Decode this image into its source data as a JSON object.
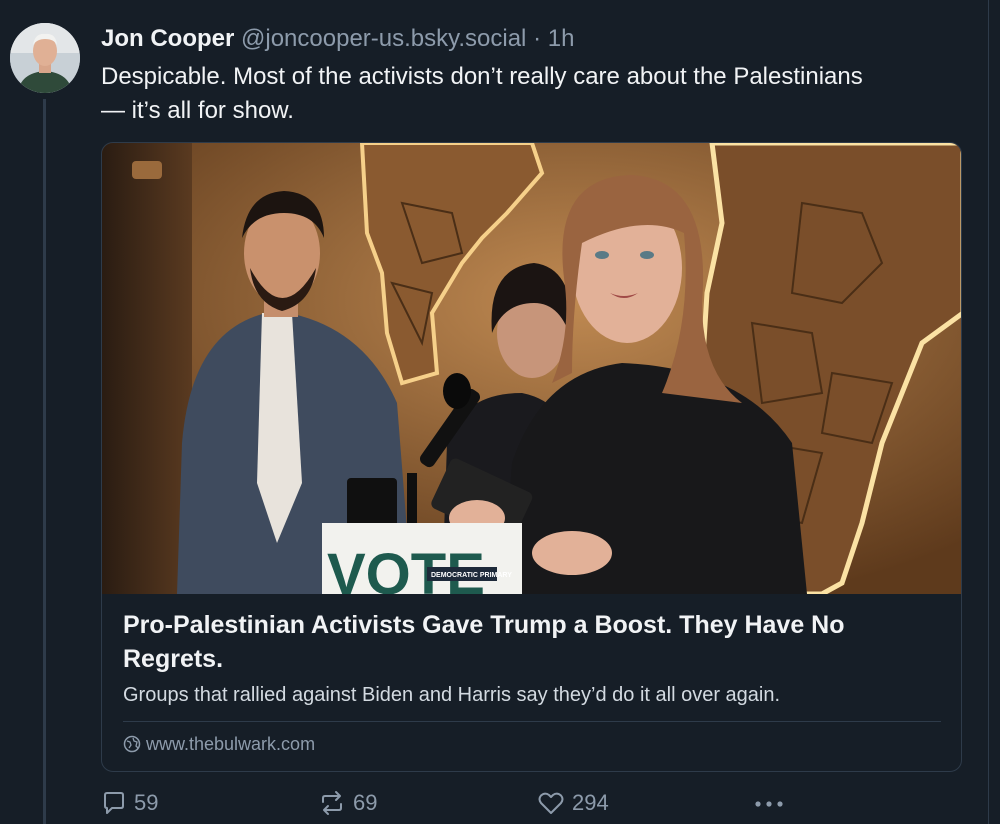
{
  "post": {
    "author_name": "Jon Cooper",
    "author_handle": "@joncooper-us.bsky.social",
    "separator": "·",
    "time": "1h",
    "text": "Despicable. Most of the activists don’t really care about the Palestinians — it’s all for show."
  },
  "embed": {
    "image_sign_text": "VOTE",
    "image_sign_small": "DEMOCRATIC PRIMARY",
    "title": "Pro-Palestinian Activists Gave Trump a Boost. They Have No Regrets.",
    "description": "Groups that rallied against Biden and Harris say they’d do it all over again.",
    "domain": "www.thebulwark.com",
    "domain_icon": "globe-icon"
  },
  "actions": {
    "reply_count": "59",
    "repost_count": "69",
    "like_count": "294",
    "reply_icon": "speech-bubble-icon",
    "repost_icon": "repost-arrows-icon",
    "like_icon": "heart-icon",
    "more_icon": "ellipsis-icon"
  },
  "colors": {
    "background": "#161e27",
    "text": "#f1f3f5",
    "muted": "#8d9bab",
    "border": "#2e3b4a"
  }
}
